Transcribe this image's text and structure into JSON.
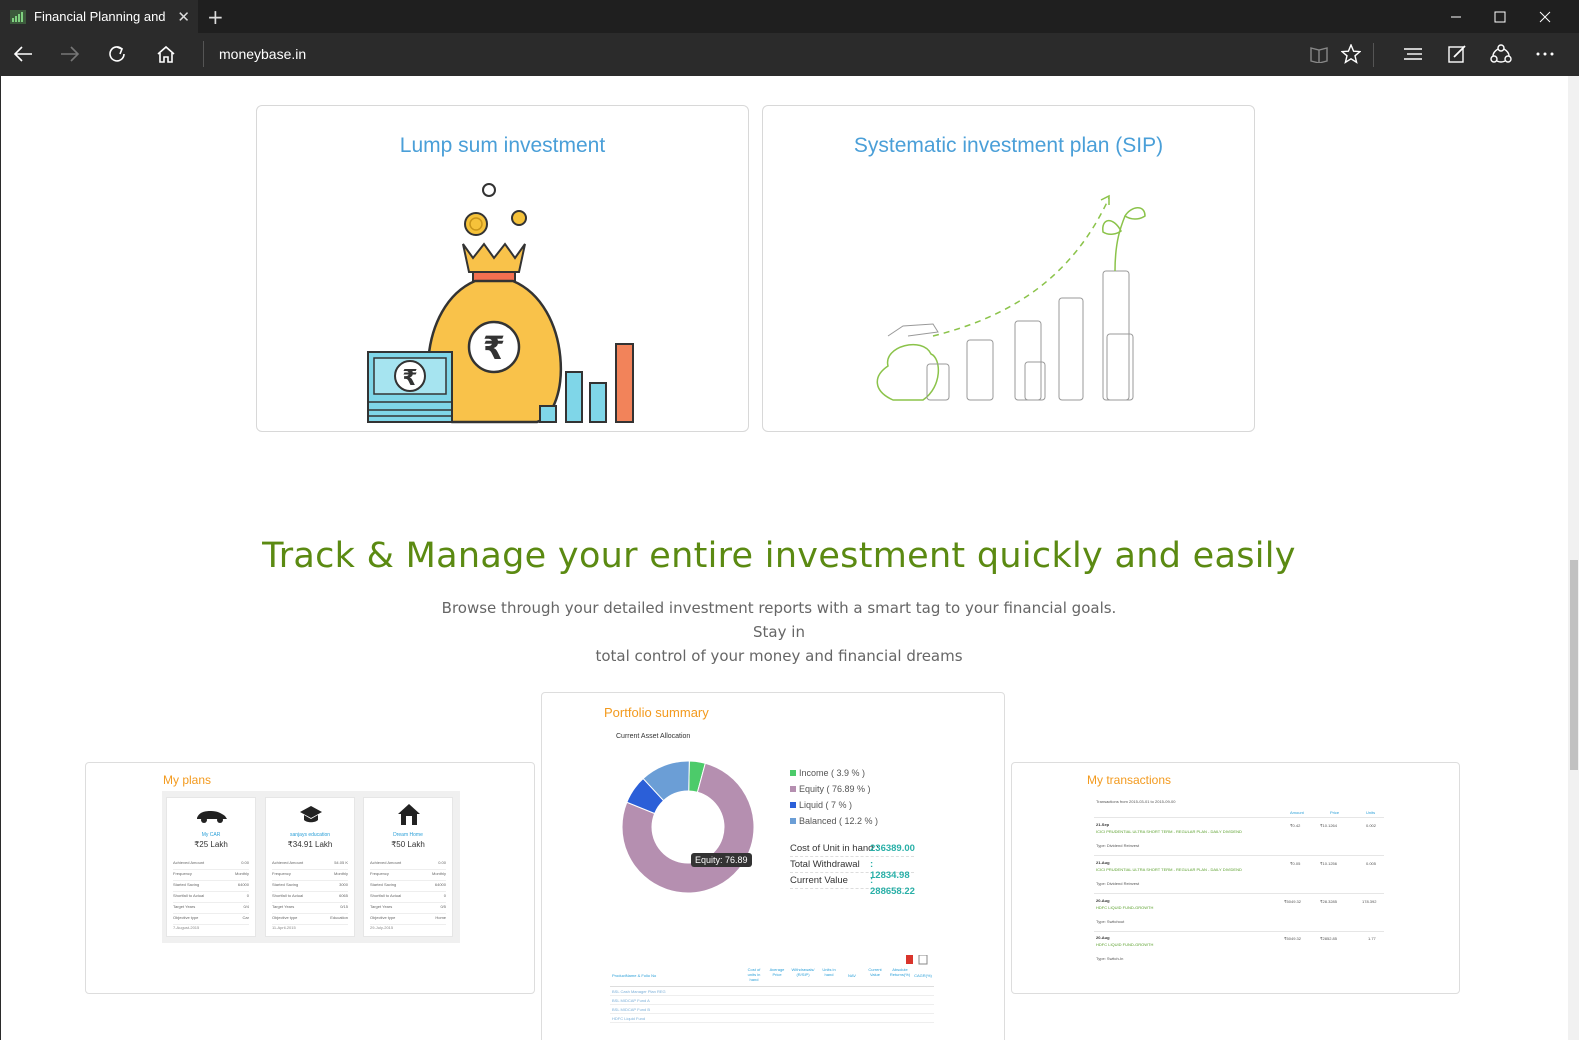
{
  "browser": {
    "tab_title": "Financial Planning and I",
    "tab_close": "✕",
    "new_tab": "+",
    "url": "moneybase.in",
    "icons": [
      "back-icon",
      "forward-icon",
      "refresh-icon",
      "home-icon",
      "reading-view-icon",
      "favorite-star-icon",
      "hub-icon",
      "web-note-icon",
      "share-icon",
      "more-icon"
    ]
  },
  "cards": {
    "lump_sum_title": "Lump sum investment",
    "sip_title": "Systematic investment plan (SIP)"
  },
  "track": {
    "title": "Track & Manage your entire investment quickly and easily",
    "subtitle_line1": "Browse through your detailed investment reports with a smart tag to your financial goals. Stay in",
    "subtitle_line2": "total control of your money and financial dreams"
  },
  "my_plans": {
    "title": "My plans",
    "plans": [
      {
        "name": "My CAR",
        "value": "₹25 Lakh",
        "rows": [
          [
            "Achieved Amount",
            "0.00"
          ],
          [
            "Frequency",
            "Monthly"
          ],
          [
            "Started Saving",
            "64000"
          ],
          [
            "Shortfall to Actual",
            "0"
          ],
          [
            "Target Years",
            "0/4"
          ],
          [
            "Objective type",
            "Car"
          ]
        ],
        "date": "7-August-2015"
      },
      {
        "name": "sanjays education",
        "value": "₹34.91 Lakh",
        "rows": [
          [
            "Achieved Amount",
            "54.05 K"
          ],
          [
            "Frequency",
            "Monthly"
          ],
          [
            "Started Saving",
            "3000"
          ],
          [
            "Shortfall to Actual",
            "6065"
          ],
          [
            "Target Years",
            "0/15"
          ],
          [
            "Objective type",
            "Education"
          ]
        ],
        "date": "11-April-2015"
      },
      {
        "name": "Dream Home",
        "value": "₹50 Lakh",
        "rows": [
          [
            "Achieved Amount",
            "0.00"
          ],
          [
            "Frequency",
            "Monthly"
          ],
          [
            "Started Saving",
            "64000"
          ],
          [
            "Shortfall to Actual",
            "0"
          ],
          [
            "Target Years",
            "0/5"
          ],
          [
            "Objective type",
            "Home"
          ]
        ],
        "date": "29-July-2015"
      }
    ]
  },
  "portfolio": {
    "title": "Portfolio summary",
    "chart_title": "Current Asset Allocation",
    "legend": [
      {
        "label": "Income ( 3.9 % )",
        "color": "#4ccb6a",
        "value": 3.9
      },
      {
        "label": "Equity ( 76.89 % )",
        "color": "#b58fb0",
        "value": 76.89
      },
      {
        "label": "Liquid ( 7 % )",
        "color": "#2b5fd8",
        "value": 7
      },
      {
        "label": "Balanced ( 12.2 % )",
        "color": "#6b9ed6",
        "value": 12.2
      }
    ],
    "tooltip": "Equity: 76.89",
    "summary": [
      {
        "label": "Cost of Unit in hand :",
        "value": "236389.00"
      },
      {
        "label": "Total Withdrawal",
        "value": ": 12834.98"
      },
      {
        "label": "Current Value",
        "value": ": 288658.22"
      }
    ],
    "table_headers": [
      "ProductName & Folio No",
      "Cost of units in hand",
      "Average Price",
      "Withdrawals/ (R/SIP)",
      "Units in hand",
      "NAV",
      "Current Value",
      "Absolute Returns(%)",
      "CAGR(%)"
    ],
    "table_rows": [
      "BSL Cash Manager Plan REG",
      "BSL MIDCAP Fund A",
      "BSL MIDCAP Fund B",
      "HDFC Liquid Fund"
    ]
  },
  "my_transactions": {
    "title": "My transactions",
    "range": "Transactions from 2015-03-01 to 2015-09-00",
    "headers": [
      "Amount",
      "Price",
      "Units"
    ],
    "items": [
      {
        "date": "21-Sep",
        "scheme": "ICICI PRUDENTIAL ULTRA SHORT TERM - REGULAR PLAN - DAILY DIVIDEND",
        "type": "Type: Dividend Reinvest",
        "amount": "₹0.42",
        "price": "₹10.1264",
        "units": "0.002"
      },
      {
        "date": "21-Aug",
        "scheme": "ICICI PRUDENTIAL ULTRA SHORT TERM - REGULAR PLAN - DAILY DIVIDEND",
        "type": "Type: Dividend Reinvest",
        "amount": "₹0.05",
        "price": "₹10.1256",
        "units": "0.005"
      },
      {
        "date": "20-Aug",
        "scheme": "HDFC LIQUID FUND-GROWTH",
        "type": "Type: Switchout",
        "amount": "₹5049.32",
        "price": "₹28.3285",
        "units": "178.392"
      },
      {
        "date": "20-Aug",
        "scheme": "HDFC LIQUID FUND-GROWTH",
        "type": "Type: Switch-In",
        "amount": "₹5049.32",
        "price": "₹2852.85",
        "units": "1.77"
      }
    ]
  }
}
